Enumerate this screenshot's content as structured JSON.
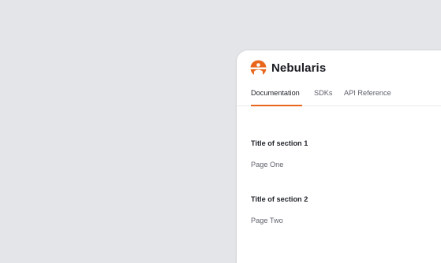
{
  "brand": {
    "name": "Nebularis",
    "accent": "#e8671c",
    "logo_icon": "nebularis-logo-icon"
  },
  "tabs": [
    {
      "label": "Documentation",
      "active": true
    },
    {
      "label": "SDKs",
      "active": false
    },
    {
      "label": "API Reference",
      "active": false
    }
  ],
  "sections": [
    {
      "title": "Title of section 1",
      "page": "Page One"
    },
    {
      "title": "Title of section 2",
      "page": "Page Two"
    }
  ]
}
